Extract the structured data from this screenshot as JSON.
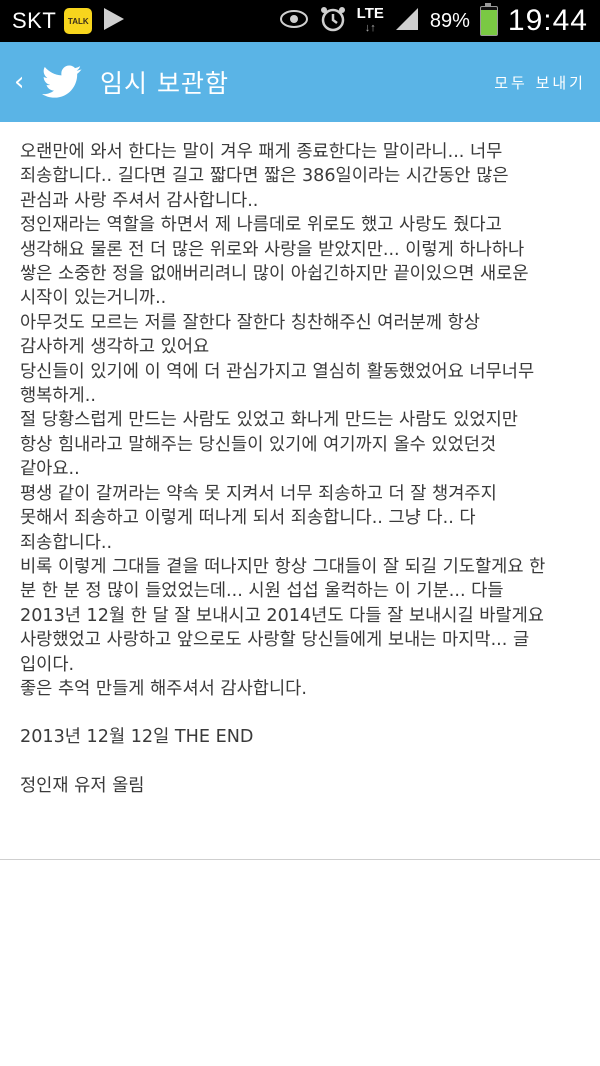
{
  "status_bar": {
    "carrier": "SKT",
    "talk_label": "TALK",
    "network": "LTE",
    "network_arrows": "↓↑",
    "battery_pct": "89%",
    "battery_level": 0.89,
    "time": "19:44"
  },
  "header": {
    "title": "임시 보관함",
    "send_all": "모두 보내기"
  },
  "message": {
    "lines": [
      "오랜만에 와서 한다는 말이 겨우 패게 종료한다는 말이라니... 너무",
      "죄송합니다.. 길다면 길고 짧다면 짧은 386일이라는 시간동안 많은",
      "관심과 사랑 주셔서 감사합니다..",
      "정인재라는 역할을 하면서 제 나름데로 위로도 했고 사랑도 줬다고",
      "생각해요 물론 전 더 많은 위로와 사랑을 받았지만... 이렇게 하나하나",
      "쌓은 소중한 정을 없애버리려니 많이 아쉽긴하지만 끝이있으면 새로운",
      "시작이 있는거니까..",
      "아무것도 모르는 저를 잘한다 잘한다 칭찬해주신 여러분께 항상",
      "감사하게 생각하고 있어요",
      "당신들이 있기에 이 역에 더 관심가지고 열심히 활동했었어요 너무너무",
      "행복하게..",
      "절 당황스럽게 만드는 사람도 있었고 화나게 만드는 사람도 있었지만",
      "항상 힘내라고 말해주는 당신들이 있기에 여기까지 올수 있었던것",
      "같아요..",
      "평생 같이 갈꺼라는 약속 못 지켜서 너무 죄송하고 더 잘 챙겨주지",
      "못해서 죄송하고 이렇게 떠나게 되서 죄송합니다.. 그냥 다.. 다",
      "죄송합니다..",
      "비록 이렇게 그대들 곁을 떠나지만 항상 그대들이 잘 되길 기도할게요 한",
      "분 한 분 정 많이 들었었는데... 시원 섭섭 울컥하는 이 기분... 다들",
      "2013년 12월 한 달 잘 보내시고 2014년도 다들 잘 보내시길 바랄게요",
      "사랑했었고 사랑하고 앞으로도 사랑할 당신들에게 보내는 마지막... 글",
      "입이다.",
      "좋은 추억 만들게 해주셔서 감사합니다."
    ],
    "date_line": "2013년 12월 12일 THE END",
    "signature": "정인재 유저 올림"
  }
}
